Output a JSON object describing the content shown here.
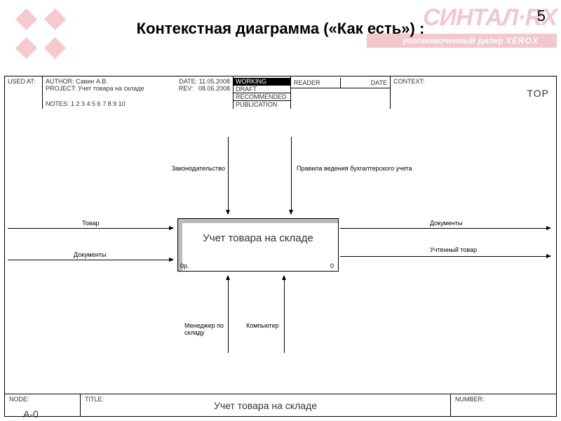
{
  "page_number": "5",
  "slide_title": "Контекстная диаграмма («Как есть») :",
  "watermark": {
    "brand": "СИНТАЛ·RX",
    "subline_prefix": "уполномоченный дилер",
    "subline_brand": "XEROX"
  },
  "header": {
    "used_at": "USED AT:",
    "author_label": "AUTHOR:",
    "author": "Савин А.В.",
    "project_label": "PROJECT:",
    "project": "Учет товара на складе",
    "notes_label": "NOTES:",
    "notes": "1 2 3 4 5 6 7 8 9 10",
    "date_label": "DATE:",
    "date": "11.05.2008",
    "rev_label": "REV:",
    "rev": "08.06.2008",
    "status": [
      "WORKING",
      "DRAFT",
      "RECOMMENDED",
      "PUBLICATION"
    ],
    "reader_label": "READER",
    "date2_label": "DATE",
    "context_label": "CONTEXT:",
    "context_value": "TOP"
  },
  "footer": {
    "node_label": "NODE:",
    "node": "A-0",
    "title_label": "TITLE:",
    "title": "Учет товара на складе",
    "number_label": "NUMBER:"
  },
  "diagram": {
    "main_function": "Учет товара на складе",
    "corner_left": "0р.",
    "corner_right": "0",
    "controls": [
      {
        "label": "Законодательство"
      },
      {
        "label": "Правила ведения бухгалтерского учета"
      }
    ],
    "inputs": [
      {
        "label": "Товар"
      },
      {
        "label": "Документы"
      }
    ],
    "outputs": [
      {
        "label": "Документы"
      },
      {
        "label": "Учтенный товар"
      }
    ],
    "mechanisms": [
      {
        "label": "Менеджер по складу"
      },
      {
        "label": "Компьютер"
      }
    ]
  }
}
